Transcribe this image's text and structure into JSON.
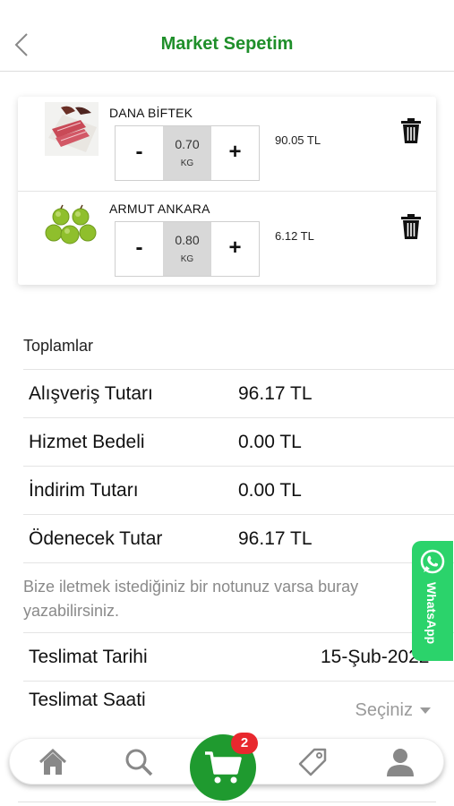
{
  "header": {
    "title": "Market Sepetim"
  },
  "cart": {
    "items": [
      {
        "name": "DANA BİFTEK",
        "quantity": "0.70",
        "unit": "KG",
        "price": "90.05 TL",
        "minus": "-",
        "plus": "+"
      },
      {
        "name": "ARMUT ANKARA",
        "quantity": "0.80",
        "unit": "KG",
        "price": "6.12 TL",
        "minus": "-",
        "plus": "+"
      }
    ]
  },
  "totals": {
    "title": "Toplamlar",
    "rows": [
      {
        "label": "Alışveriş Tutarı",
        "value": "96.17 TL"
      },
      {
        "label": "Hizmet Bedeli",
        "value": "0.00 TL"
      },
      {
        "label": "İndirim Tutarı",
        "value": "0.00 TL"
      },
      {
        "label": "Ödenecek Tutar",
        "value": "96.17 TL"
      }
    ]
  },
  "note": {
    "line1": "Bize iletmek istediğiniz bir notunuz varsa buray",
    "line2": "yazabilirsiniz."
  },
  "delivery": {
    "date_label": "Teslimat Tarihi",
    "date_value": "15-Şub-2022",
    "time_label": "Teslimat Saati",
    "time_placeholder": "Seçiniz"
  },
  "whatsapp": {
    "label": "WhatsApp",
    "color": "#2bd36b"
  },
  "nav": {
    "icons": [
      "home-icon",
      "search-icon",
      "cart-icon",
      "tag-icon",
      "user-icon"
    ],
    "cart_badge": "2"
  },
  "colors": {
    "brand_green": "#1f8f2a",
    "cart_green": "#1f9a2f",
    "badge_red": "#e8282e"
  }
}
